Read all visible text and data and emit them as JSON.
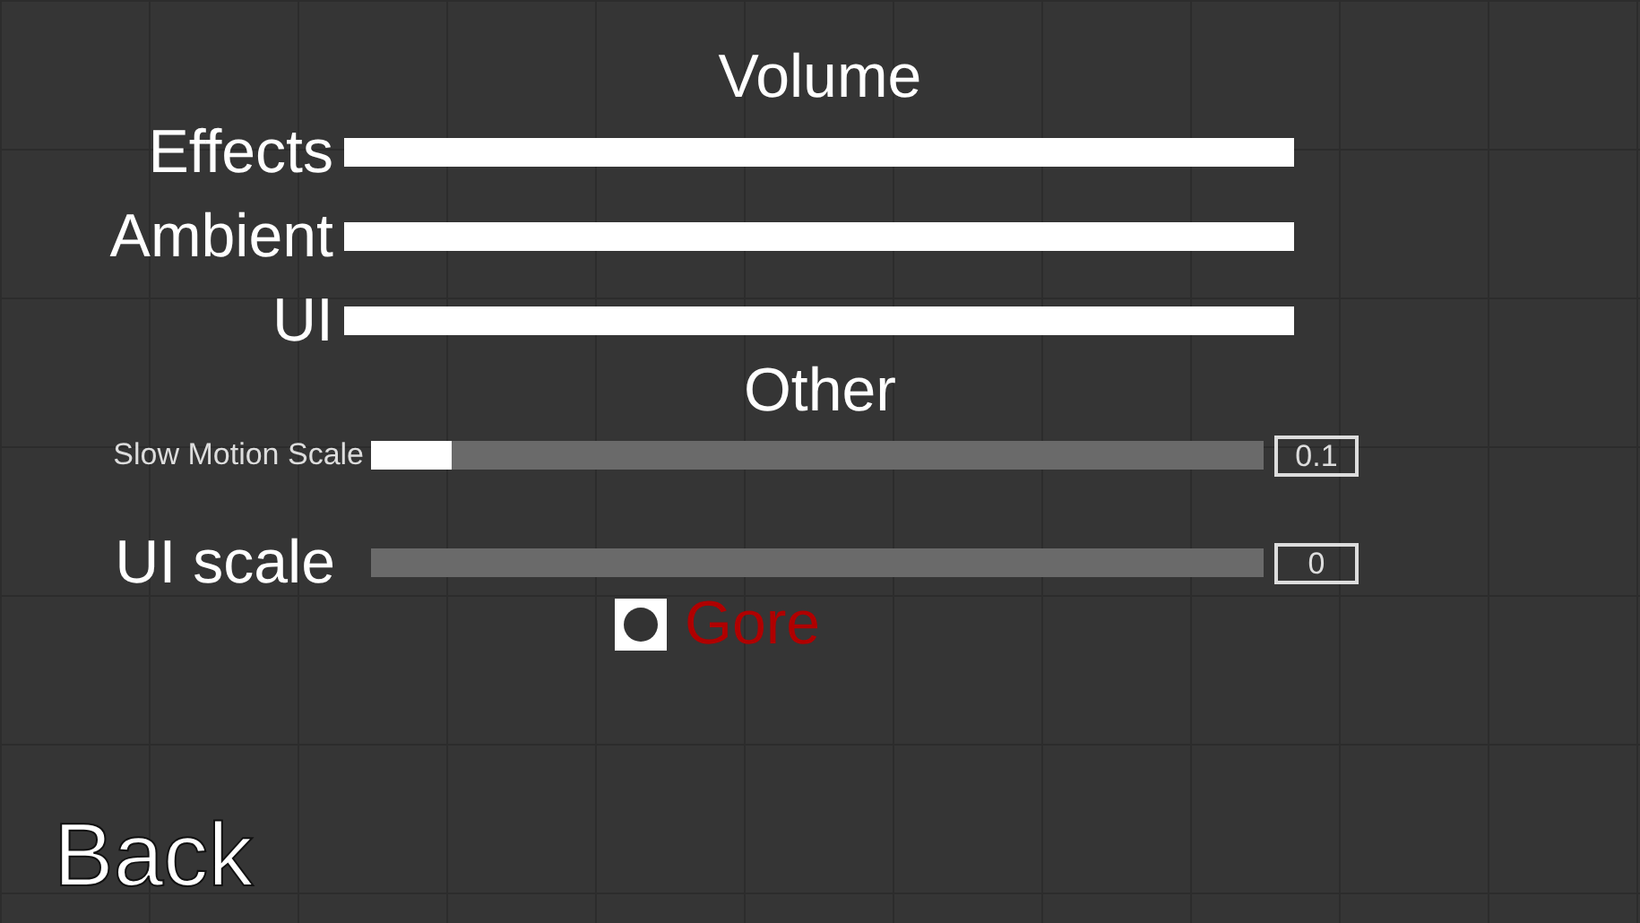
{
  "volume": {
    "title": "Volume",
    "sliders": [
      {
        "label": "Effects",
        "level": 1
      },
      {
        "label": "Ambient",
        "level": 1
      },
      {
        "label": "UI",
        "level": 1
      }
    ]
  },
  "other": {
    "title": "Other",
    "sliders": [
      {
        "label": "Slow Motion Scale",
        "kind": "small",
        "level": 0.09,
        "reading": "0.1"
      },
      {
        "label": "UI scale",
        "kind": "large",
        "level": 0,
        "reading": "0"
      }
    ],
    "toggle": {
      "label": "Gore",
      "checked": true
    }
  },
  "back_button": "Back"
}
